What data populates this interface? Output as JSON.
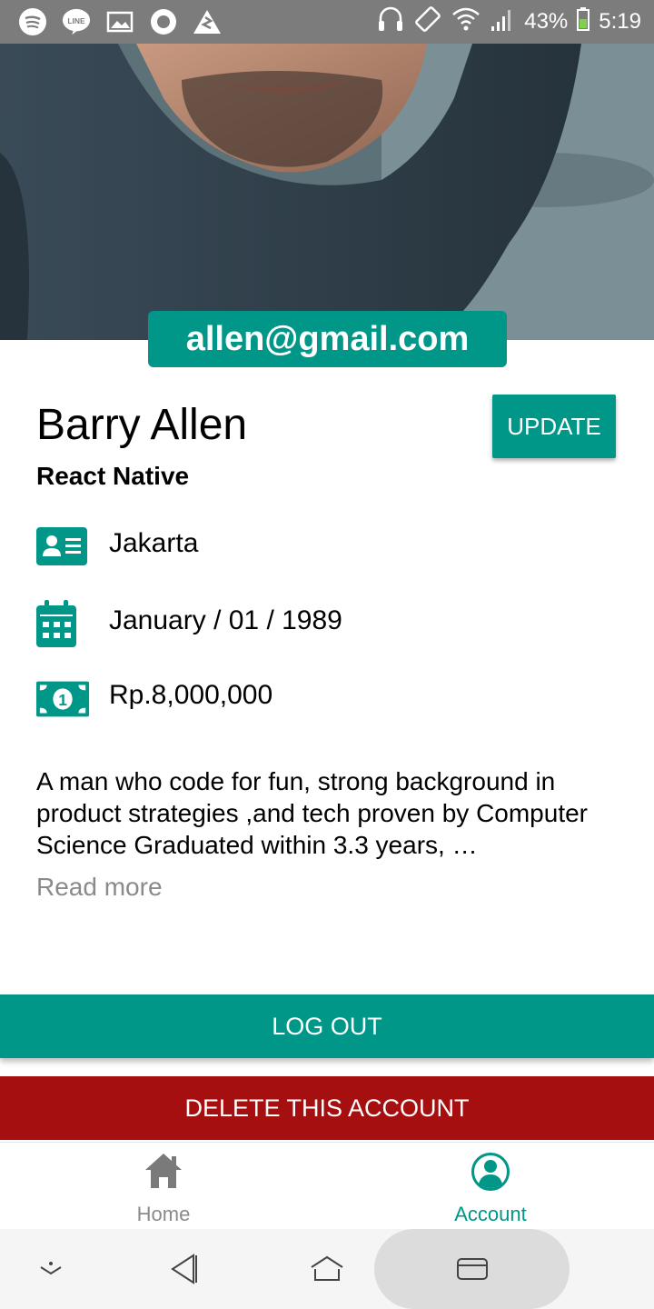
{
  "status_bar": {
    "battery": "43%",
    "time": "5:19",
    "icons": [
      "spotify-icon",
      "line-icon",
      "gallery-icon",
      "circle-app-icon",
      "warning-app-icon",
      "headset-icon",
      "rotate-icon",
      "wifi-icon",
      "signal-icon",
      "battery-icon"
    ],
    "line_label": "LINE"
  },
  "profile": {
    "email": "allen@gmail.com",
    "name": "Barry Allen",
    "role": "React Native",
    "update_label": "UPDATE",
    "info": [
      {
        "icon": "id-card-icon",
        "text": "Jakarta"
      },
      {
        "icon": "calendar-icon",
        "text": "January / 01 / 1989"
      },
      {
        "icon": "money-icon",
        "text": "Rp.8,000,000"
      }
    ],
    "bio": "A man who code for fun, strong background in product strategies ,and tech proven by Computer Science Graduated within 3.3 years, …",
    "read_more": "Read more"
  },
  "actions": {
    "logout_label": "LOG OUT",
    "delete_label": "DELETE THIS ACCOUNT"
  },
  "bottom_nav": {
    "tabs": [
      {
        "label": "Home",
        "icon": "home-icon",
        "active": false
      },
      {
        "label": "Account",
        "icon": "account-icon",
        "active": true
      }
    ]
  },
  "colors": {
    "primary": "#009688",
    "danger": "#a50f0f",
    "inactive": "#8a8a8a",
    "status_bar": "#7c7c7c"
  }
}
